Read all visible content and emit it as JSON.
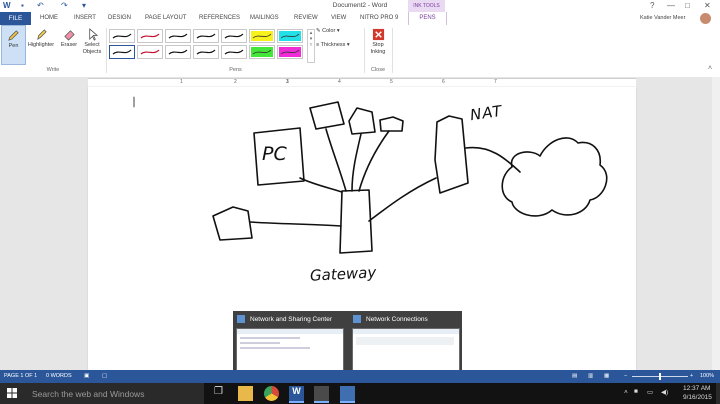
{
  "window": {
    "title": "Document2 - Word",
    "context_tab_group": "INK TOOLS",
    "quick_access": [
      "save-icon",
      "undo-icon",
      "redo-icon",
      "customize-icon"
    ],
    "controls": [
      "?",
      "—",
      "□",
      "✕"
    ]
  },
  "tabs": [
    {
      "label": "FILE"
    },
    {
      "label": "HOME"
    },
    {
      "label": "INSERT"
    },
    {
      "label": "DESIGN"
    },
    {
      "label": "PAGE LAYOUT"
    },
    {
      "label": "REFERENCES"
    },
    {
      "label": "MAILINGS"
    },
    {
      "label": "REVIEW"
    },
    {
      "label": "VIEW"
    },
    {
      "label": "NITRO PRO 9"
    },
    {
      "label": "PENS"
    }
  ],
  "user": {
    "name": "Katie Vander Meer"
  },
  "ribbon": {
    "write_group": {
      "label": "Write",
      "buttons": [
        {
          "label": "Pen",
          "icon": "pen-icon"
        },
        {
          "label": "Highlighter",
          "icon": "highlighter-icon"
        },
        {
          "label": "Eraser",
          "icon": "eraser-icon"
        },
        {
          "label": "Select Objects",
          "icon": "select-objects-icon"
        }
      ]
    },
    "pens_group": {
      "label": "Pens",
      "pen_colors": [
        "#111111",
        "#c8102e",
        "#111111",
        "#111111",
        "#111111",
        "#f7f21b",
        "#22e0e8",
        "#111111",
        "#c8102e",
        "#111111",
        "#111111",
        "#111111",
        "#44e63a",
        "#f02bd8"
      ],
      "color_label": "Color",
      "thickness_label": "Thickness"
    },
    "close_group": {
      "label": "Close",
      "stop_inking_label": "Stop Inking"
    }
  },
  "ruler": {
    "numbers": [
      "1",
      "1",
      "2",
      "3",
      "4",
      "5",
      "6",
      "7"
    ]
  },
  "drawing": {
    "labels": [
      "PC",
      "NAT",
      "Gateway"
    ]
  },
  "taskbar": {
    "search_placeholder": "Search the web and Windows",
    "time": "12:37 AM",
    "date": "9/16/2015",
    "thumbnails": [
      {
        "title": "Network and Sharing Center"
      },
      {
        "title": "Network Connections"
      }
    ]
  },
  "status": {
    "page": "PAGE 1 OF 1",
    "words": "0 WORDS",
    "zoom": "100%"
  },
  "colors": {
    "accent": "#2b579a",
    "ink_tools": "#7a3d9d"
  }
}
